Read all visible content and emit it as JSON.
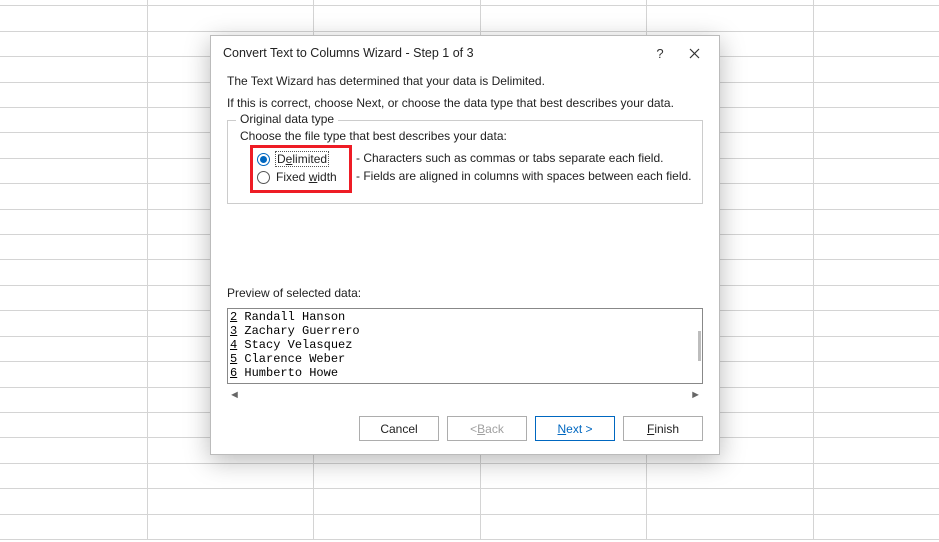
{
  "dialog": {
    "title": "Convert Text to Columns Wizard - Step 1 of 3",
    "intro1": "The Text Wizard has determined that your data is Delimited.",
    "intro2": "If this is correct, choose Next, or choose the data type that best describes your data.",
    "group_legend": "Original data type",
    "choose_label": "Choose the file type that best describes your data:",
    "radios": {
      "delimited": {
        "label_pre": "D",
        "label_u": "e",
        "label_post": "limited",
        "desc": "- Characters such as commas or tabs separate each field."
      },
      "fixed": {
        "label_pre": "Fixed ",
        "label_u": "w",
        "label_post": "idth",
        "desc": "- Fields are aligned in columns with spaces between each field."
      }
    },
    "preview_label": "Preview of selected data:",
    "preview_rows": [
      {
        "n": "2",
        "text": "Randall Hanson"
      },
      {
        "n": "3",
        "text": "Zachary Guerrero"
      },
      {
        "n": "4",
        "text": "Stacy Velasquez"
      },
      {
        "n": "5",
        "text": "Clarence Weber"
      },
      {
        "n": "6",
        "text": "Humberto Howe"
      }
    ],
    "buttons": {
      "cancel": "Cancel",
      "back_pre": "< ",
      "back_u": "B",
      "back_post": "ack",
      "next_u": "N",
      "next_post": "ext >",
      "finish_u": "F",
      "finish_post": "inish"
    }
  }
}
